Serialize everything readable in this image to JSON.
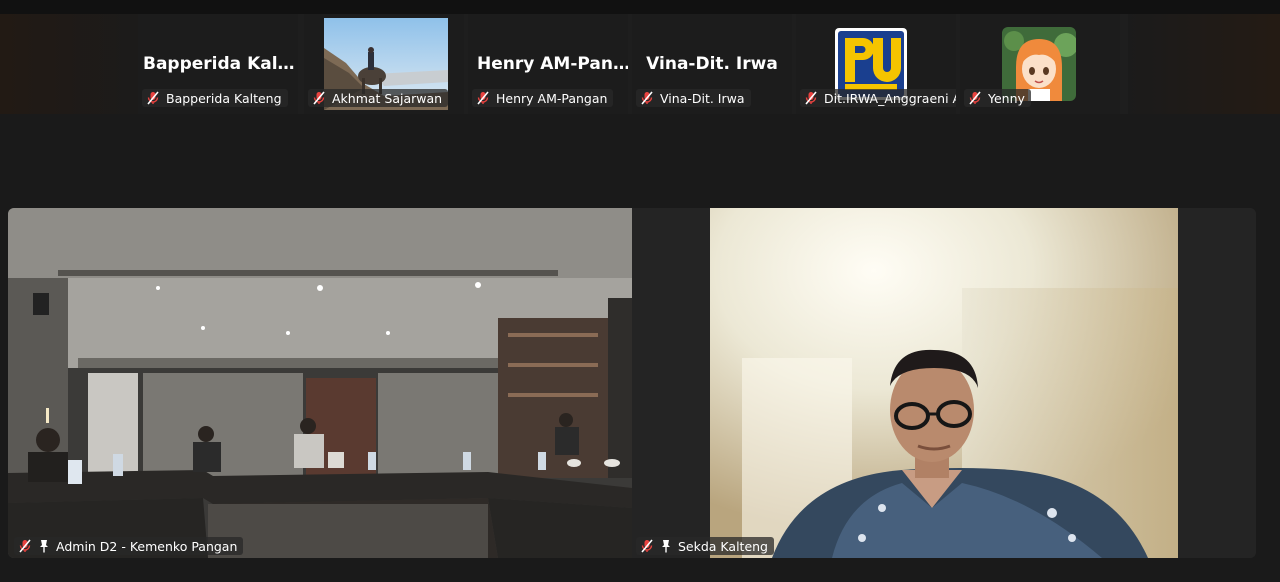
{
  "gallery": {
    "tiles": [
      {
        "display_name": "Bapperida  Kalte...",
        "label": "Bapperida Kalteng",
        "muted": true
      },
      {
        "display_name": "",
        "label": "Akhmat Sajarwan",
        "muted": true
      },
      {
        "display_name": "Henry  AM-Pan...",
        "label": "Henry AM-Pangan",
        "muted": true
      },
      {
        "display_name": "Vina-Dit. Irwa",
        "label": "Vina-Dit. Irwa",
        "muted": true
      },
      {
        "display_name": "",
        "label": "Dit.IRWA_Anggraeni A",
        "muted": true
      },
      {
        "display_name": "",
        "label": "Yenny",
        "muted": true
      }
    ]
  },
  "main": {
    "left": {
      "label": "Admin D2 - Kemenko Pangan",
      "muted": true,
      "pinned": true
    },
    "right": {
      "label": "Sekda Kalteng",
      "muted": true,
      "pinned": true
    }
  },
  "colors": {
    "muted_icon": "#e8423f",
    "background": "#1a1a1a"
  }
}
